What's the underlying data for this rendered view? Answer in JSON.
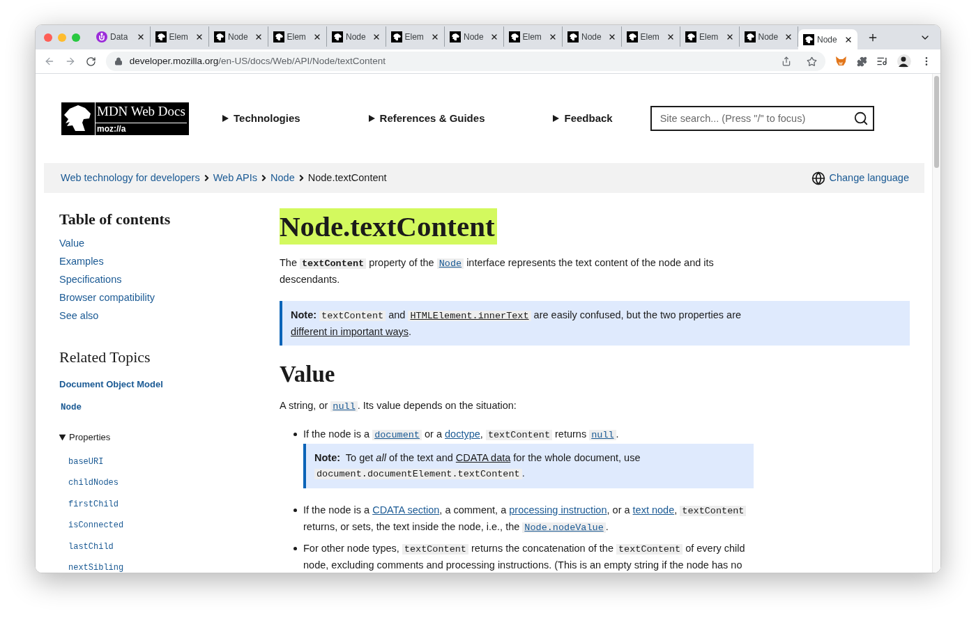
{
  "tabs": [
    {
      "label": "Data",
      "kind": "circle",
      "selected": false
    },
    {
      "label": "Elem",
      "kind": "mdn",
      "selected": false
    },
    {
      "label": "Node",
      "kind": "mdn",
      "selected": false
    },
    {
      "label": "Elem",
      "kind": "mdn",
      "selected": false
    },
    {
      "label": "Node",
      "kind": "mdn",
      "selected": false
    },
    {
      "label": "Elem",
      "kind": "mdn",
      "selected": false
    },
    {
      "label": "Node",
      "kind": "mdn",
      "selected": false
    },
    {
      "label": "Elem",
      "kind": "mdn",
      "selected": false
    },
    {
      "label": "Node",
      "kind": "mdn",
      "selected": false
    },
    {
      "label": "Elem",
      "kind": "mdn",
      "selected": false
    },
    {
      "label": "Elem",
      "kind": "mdn",
      "selected": false
    },
    {
      "label": "Node",
      "kind": "mdn",
      "selected": false
    },
    {
      "label": "Node",
      "kind": "mdn",
      "selected": true
    }
  ],
  "address": {
    "host": "developer.mozilla.org",
    "path": "/en-US/docs/Web/API/Node/textContent"
  },
  "logo": {
    "title": "MDN Web Docs",
    "subtitle": "moz://a"
  },
  "nav": [
    "Technologies",
    "References & Guides",
    "Feedback"
  ],
  "search": {
    "placeholder": "Site search... (Press \"/\" to focus)"
  },
  "breadcrumbs": [
    {
      "label": "Web technology for developers",
      "kind": "link"
    },
    {
      "label": "Web APIs",
      "kind": "link"
    },
    {
      "label": "Node",
      "kind": "link"
    },
    {
      "label": "Node.textContent",
      "kind": "current"
    }
  ],
  "change_language": "Change language",
  "toc": {
    "title": "Table of contents",
    "items": [
      "Value",
      "Examples",
      "Specifications",
      "Browser compatibility",
      "See also"
    ]
  },
  "related": {
    "title": "Related Topics",
    "section": "Document Object Model",
    "interface": "Node",
    "group": {
      "label": "Properties",
      "expanded": true,
      "items": [
        "baseURI",
        "childNodes",
        "firstChild",
        "isConnected",
        "lastChild",
        "nextSibling"
      ]
    }
  },
  "article": {
    "title": "Node.textContent",
    "intro": [
      {
        "kind": "text",
        "t": "The "
      },
      {
        "kind": "strongcode",
        "t": "textContent"
      },
      {
        "kind": "text",
        "t": " property of the "
      },
      {
        "kind": "codelink",
        "t": "Node"
      },
      {
        "kind": "text",
        "t": " interface represents the text content of the node and its descendants."
      }
    ],
    "note": [
      {
        "kind": "strong",
        "t": "Note:"
      },
      {
        "kind": "code",
        "t": "textContent"
      },
      {
        "kind": "text",
        "t": " and "
      },
      {
        "kind": "codeplain",
        "t": "HTMLElement.innerText"
      },
      {
        "kind": "text",
        "t": " are easily confused, but the two properties are "
      },
      {
        "kind": "plainlink",
        "t": "different in important ways"
      },
      {
        "kind": "text",
        "t": "."
      }
    ],
    "heading": "Value",
    "value_intro": [
      {
        "kind": "text",
        "t": "A string, or "
      },
      {
        "kind": "codelink",
        "t": "null"
      },
      {
        "kind": "text",
        "t": ". Its value depends on the situation:"
      }
    ],
    "bullets": [
      {
        "segments": [
          {
            "kind": "text",
            "t": "If the node is a "
          },
          {
            "kind": "codelink",
            "t": "document"
          },
          {
            "kind": "text",
            "t": " or a "
          },
          {
            "kind": "link",
            "t": "doctype"
          },
          {
            "kind": "text",
            "t": ", "
          },
          {
            "kind": "code",
            "t": "textContent"
          },
          {
            "kind": "text",
            "t": " returns "
          },
          {
            "kind": "codelink",
            "t": "null"
          },
          {
            "kind": "text",
            "t": "."
          }
        ],
        "note": [
          {
            "kind": "strong",
            "t": "Note:"
          },
          {
            "kind": "text",
            "t": " To get "
          },
          {
            "kind": "em",
            "t": "all"
          },
          {
            "kind": "text",
            "t": " of the text and "
          },
          {
            "kind": "plainlink",
            "t": "CDATA data"
          },
          {
            "kind": "text",
            "t": " for the whole document, use "
          },
          {
            "kind": "code",
            "t": "document.documentElement.textContent"
          },
          {
            "kind": "text",
            "t": "."
          }
        ]
      },
      {
        "segments": [
          {
            "kind": "text",
            "t": "If the node is a "
          },
          {
            "kind": "link",
            "t": "CDATA section"
          },
          {
            "kind": "text",
            "t": ", a comment, a "
          },
          {
            "kind": "link",
            "t": "processing instruction"
          },
          {
            "kind": "text",
            "t": ", or a "
          },
          {
            "kind": "link",
            "t": "text node"
          },
          {
            "kind": "text",
            "t": ", "
          },
          {
            "kind": "code",
            "t": "textContent"
          },
          {
            "kind": "text",
            "t": " returns, or sets, the text inside the node, i.e., the "
          },
          {
            "kind": "codelink",
            "t": "Node.nodeValue"
          },
          {
            "kind": "text",
            "t": "."
          }
        ]
      },
      {
        "segments": [
          {
            "kind": "text",
            "t": "For other node types, "
          },
          {
            "kind": "code",
            "t": "textContent"
          },
          {
            "kind": "text",
            "t": " returns the concatenation of the "
          },
          {
            "kind": "code",
            "t": "textContent"
          },
          {
            "kind": "text",
            "t": " of every child node, excluding comments and processing instructions. (This is an empty string if the node has no"
          }
        ]
      }
    ]
  }
}
